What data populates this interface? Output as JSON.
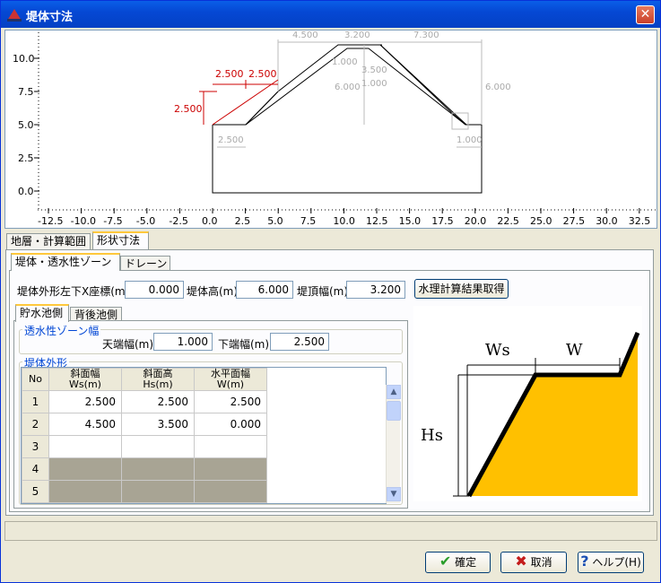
{
  "window": {
    "title": "堤体寸法",
    "close_label": "✕"
  },
  "preview": {
    "y_ticks": [
      "10.0",
      "7.5",
      "5.0",
      "2.5",
      "0.0"
    ],
    "x_ticks": [
      "-12.5",
      "-10.0",
      "-7.5",
      "-5.0",
      "-2.5",
      "0.0",
      "2.5",
      "5.0",
      "7.5",
      "10.0",
      "12.5",
      "15.0",
      "17.5",
      "20.0",
      "22.5",
      "25.0",
      "27.5",
      "30.0",
      "32.5"
    ],
    "dims_red": [
      "2.500",
      "2.500",
      "2.500"
    ],
    "dims_grey": [
      "4.500",
      "3.200",
      "7.300",
      "1.000",
      "3.500",
      "1.000",
      "6.000",
      "6.000",
      "2.500",
      "1.000"
    ]
  },
  "tabs_l1": [
    "地層・計算範囲",
    "形状寸法"
  ],
  "tabs_l2": [
    "堤体・透水性ゾーン",
    "ドレーン"
  ],
  "tabs_l3": [
    "貯水池側",
    "背後池側"
  ],
  "form": {
    "x_label": "堤体外形左下X座標(m)",
    "x_value": "0.000",
    "height_label": "堤体高(m)",
    "height_value": "6.000",
    "crest_label": "堤頂幅(m)",
    "crest_value": "3.200",
    "fetch_button": "水理計算結果取得"
  },
  "zone": {
    "title": "透水性ゾーン幅",
    "top_label": "天端幅(m)",
    "top_value": "1.000",
    "bottom_label": "下端幅(m)",
    "bottom_value": "2.500"
  },
  "outline": {
    "title": "堤体外形",
    "headers": [
      "No",
      "斜面幅\nWs(m)",
      "斜面高\nHs(m)",
      "水平面幅\nW(m)"
    ],
    "rows": [
      [
        "1",
        "2.500",
        "2.500",
        "2.500"
      ],
      [
        "2",
        "4.500",
        "3.500",
        "0.000"
      ],
      [
        "3",
        "",
        "",
        ""
      ],
      [
        "4",
        "",
        "",
        ""
      ],
      [
        "5",
        "",
        "",
        ""
      ]
    ]
  },
  "diagram": {
    "ws": "Ws",
    "w": "W",
    "hs": "Hs",
    "fill": "#ffc000"
  },
  "footer": {
    "ok": "確定",
    "cancel": "取消",
    "help": "ヘルプ(H)"
  }
}
